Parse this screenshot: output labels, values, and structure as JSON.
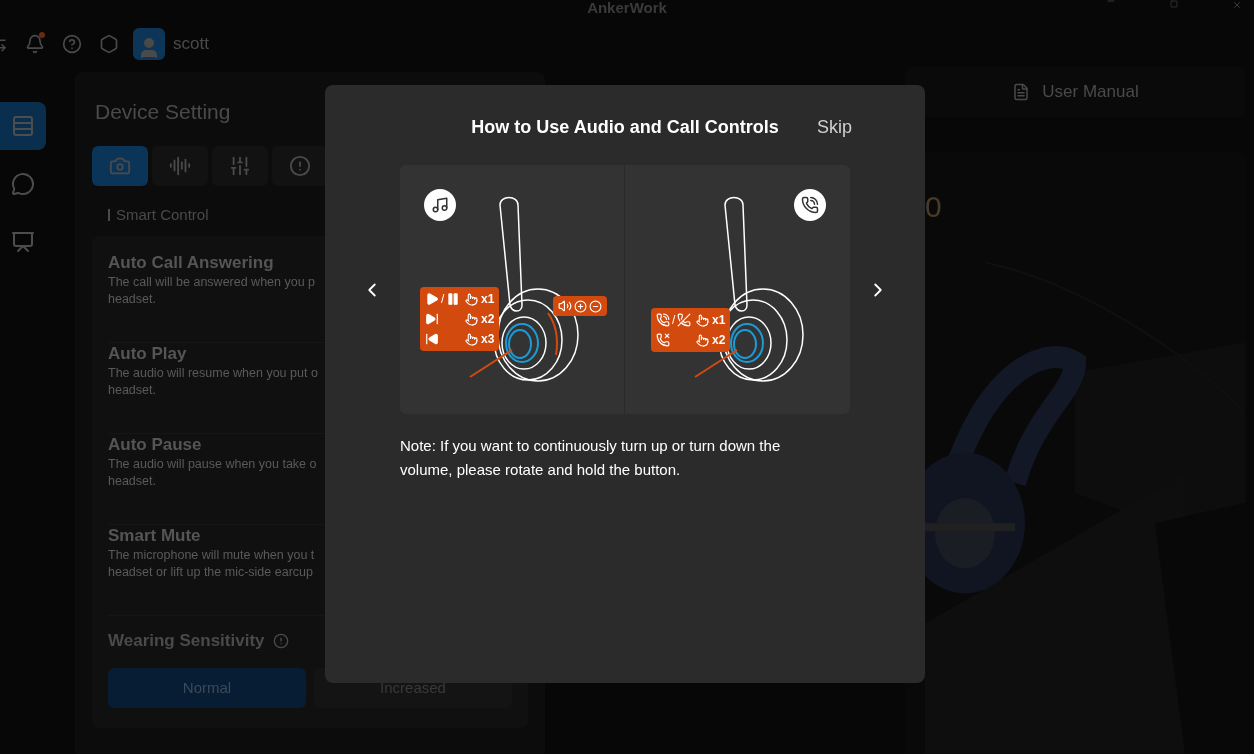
{
  "app_title": "AnkerWork",
  "header": {
    "notification_dot": true,
    "username": "scott"
  },
  "nav": [
    {
      "kind": "devices",
      "selected": true
    },
    {
      "kind": "chat",
      "selected": false
    },
    {
      "kind": "presentation",
      "selected": false
    }
  ],
  "device_setting": {
    "title": "Device Setting",
    "tabs": [
      {
        "kind": "device",
        "selected": true
      },
      {
        "kind": "audio",
        "selected": false
      },
      {
        "kind": "equalizer",
        "selected": false
      },
      {
        "kind": "info",
        "selected": false
      }
    ],
    "section": "Smart Control",
    "items": [
      {
        "title": "Auto Call Answering",
        "description_lines": [
          "The call will be answered when you p",
          "headset."
        ]
      },
      {
        "title": "Auto Play",
        "description_lines": [
          "The audio will resume when you put o",
          "headset."
        ]
      },
      {
        "title": "Auto Pause",
        "description_lines": [
          "The audio will pause when you take o",
          "headset."
        ]
      },
      {
        "title": "Smart Mute",
        "description_lines": [
          "The microphone will mute when you t",
          "headset or lift up the mic-side earcup"
        ]
      }
    ],
    "sensitivity": {
      "title": "Wearing Sensitivity",
      "options": [
        {
          "label": "Normal",
          "selected": true
        },
        {
          "label": "Increased",
          "selected": false
        }
      ]
    }
  },
  "user_manual": "User Manual",
  "product_text": "0",
  "modal": {
    "title": "How to Use Audio and Call Controls",
    "skip": "Skip",
    "music_callout": [
      {
        "kind": "play-pause",
        "separator": "/",
        "count": "x1"
      },
      {
        "kind": "next",
        "count": "x2"
      },
      {
        "kind": "previous",
        "count": "x3"
      }
    ],
    "call_callout": [
      {
        "kind": "answer-end",
        "separator": "/",
        "count": "x1"
      },
      {
        "kind": "reject",
        "count": "x2"
      }
    ],
    "note": "Note: If you want to continuously turn up or turn down the volume, please rotate and hold the button."
  }
}
